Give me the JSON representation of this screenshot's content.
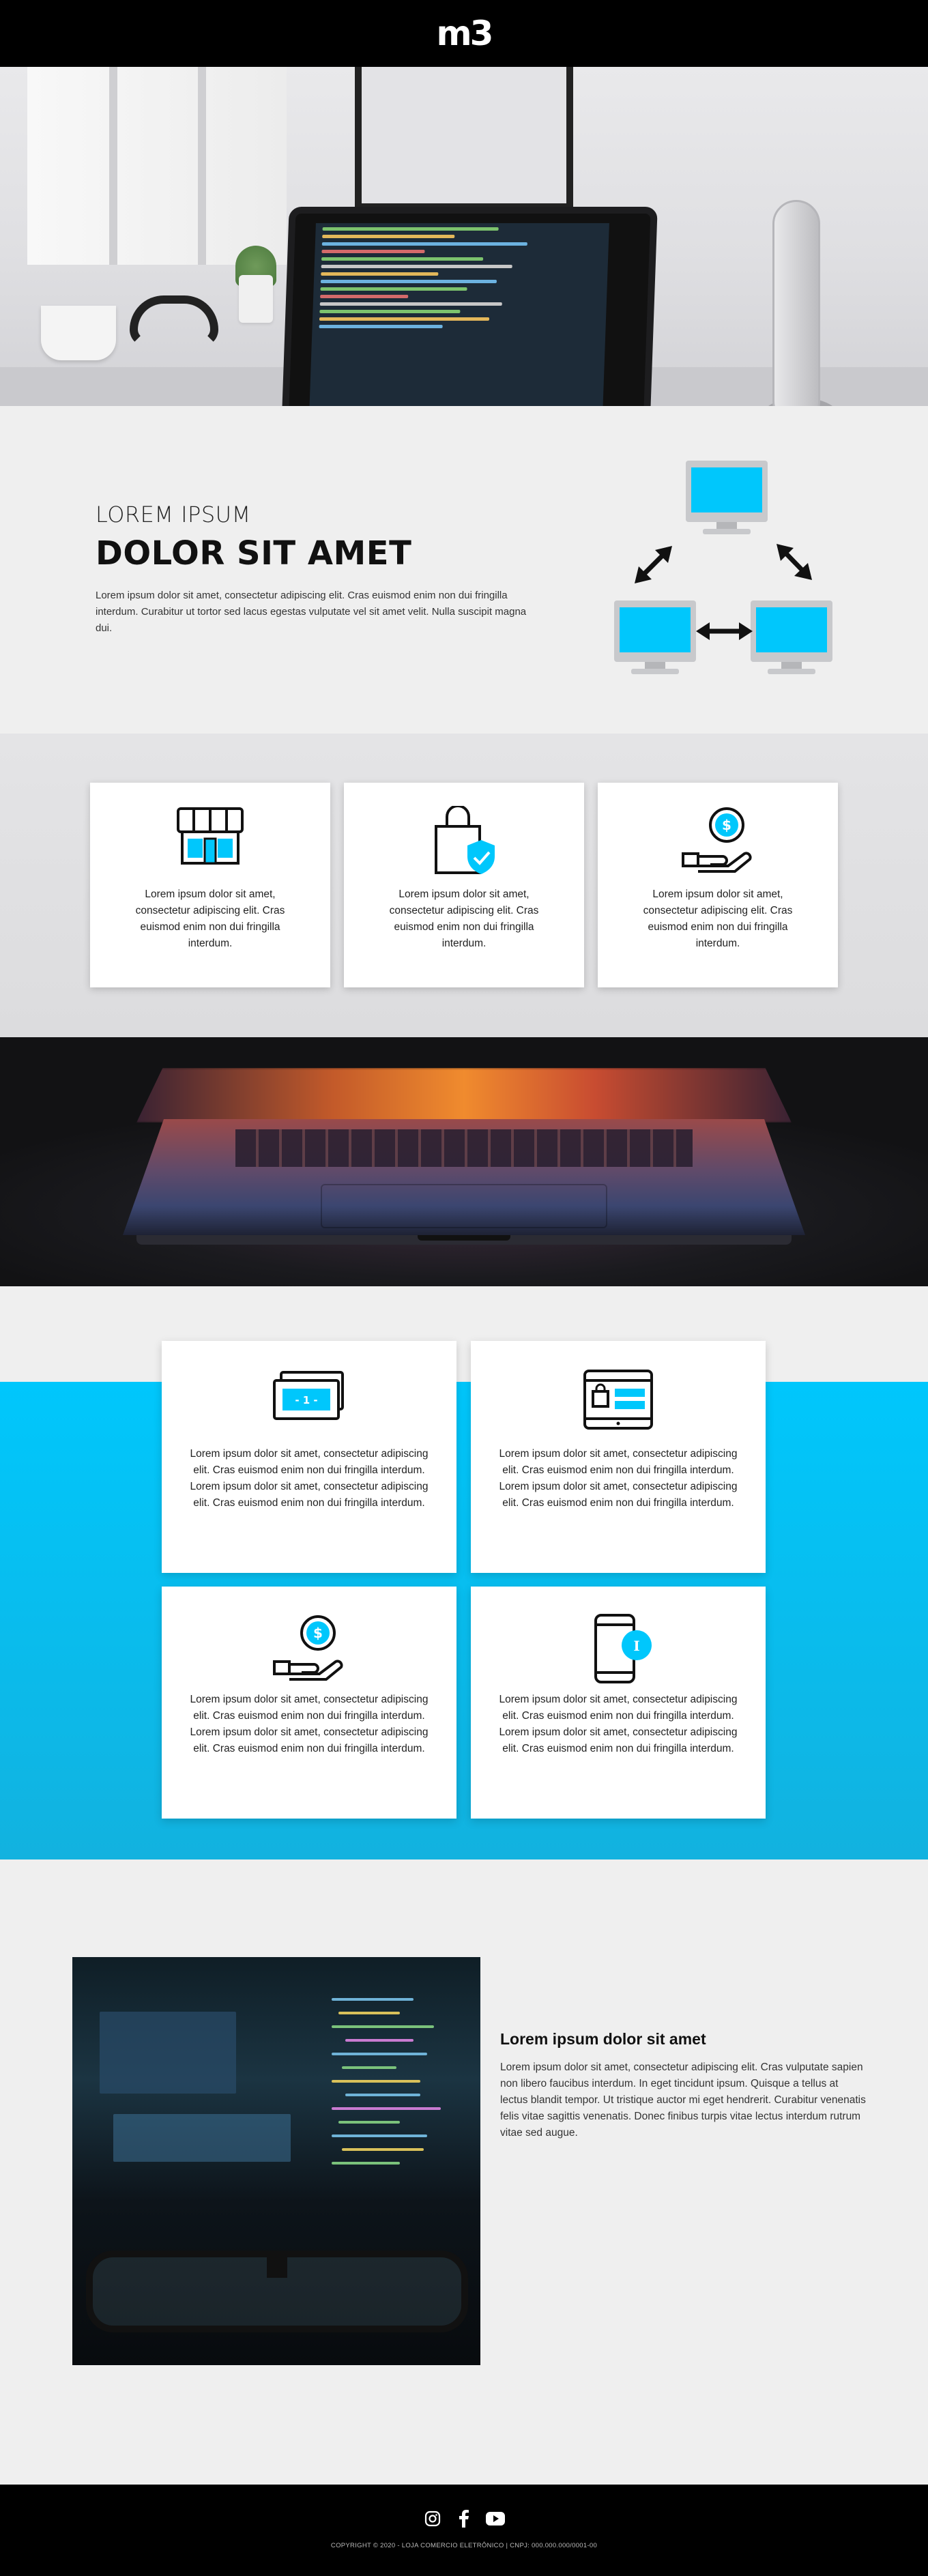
{
  "header": {
    "logo_text": "m3"
  },
  "intro": {
    "subtitle": "LOREM IPSUM",
    "title": "DOLOR SIT AMET",
    "paragraph": "Lorem ipsum dolor sit amet, consectetur adipiscing elit. Cras euismod enim non dui fringilla interdum. Curabitur ut tortor sed lacus egestas vulputate vel sit amet velit. Nulla suscipit magna dui."
  },
  "features": {
    "cards": [
      {
        "icon": "storefront-icon",
        "text": "Lorem ipsum dolor sit amet, consectetur adipiscing elit. Cras euismod enim non dui fringilla interdum."
      },
      {
        "icon": "shopping-bag-shield-icon",
        "text": "Lorem ipsum dolor sit amet, consectetur adipiscing elit. Cras euismod enim non dui fringilla interdum."
      },
      {
        "icon": "hand-coin-icon",
        "text": "Lorem ipsum dolor sit amet, consectetur adipiscing elit. Cras euismod enim non dui fringilla interdum."
      }
    ]
  },
  "grid": {
    "cards": [
      {
        "icon": "banknotes-icon",
        "badge": "- 1 -",
        "text": "Lorem ipsum dolor sit amet, consectetur adipiscing elit. Cras euismod enim non dui fringilla interdum. Lorem ipsum dolor sit amet, consectetur adipiscing elit. Cras euismod enim non dui fringilla interdum."
      },
      {
        "icon": "online-store-icon",
        "text": "Lorem ipsum dolor sit amet, consectetur adipiscing elit. Cras euismod enim non dui fringilla interdum. Lorem ipsum dolor sit amet, consectetur adipiscing elit. Cras euismod enim non dui fringilla interdum."
      },
      {
        "icon": "hand-coin-icon",
        "text": "Lorem ipsum dolor sit amet, consectetur adipiscing elit. Cras euismod enim non dui fringilla interdum. Lorem ipsum dolor sit amet, consectetur adipiscing elit. Cras euismod enim non dui fringilla interdum."
      },
      {
        "icon": "smartphone-info-icon",
        "text": "Lorem ipsum dolor sit amet, consectetur adipiscing elit. Cras euismod enim non dui fringilla interdum. Lorem ipsum dolor sit amet, consectetur adipiscing elit. Cras euismod enim non dui fringilla interdum."
      }
    ]
  },
  "article": {
    "title": "Lorem ipsum dolor sit amet",
    "paragraph": "Lorem ipsum dolor sit amet, consectetur adipiscing elit. Cras vulputate sapien non libero faucibus interdum. In eget tincidunt ipsum. Quisque a tellus at lectus blandit tempor. Ut tristique auctor mi eget hendrerit. Curabitur venenatis felis vitae sagittis venenatis. Donec finibus turpis vitae lectus interdum rutrum vitae sed augue."
  },
  "footer": {
    "social": [
      "instagram-icon",
      "facebook-icon",
      "youtube-icon"
    ],
    "copyright": "COPYRIGHT © 2020 - LOJA COMERCIO ELETRÔNICO | CNPJ: 000.000.000/0001-00"
  },
  "colors": {
    "accent": "#00c7fc",
    "dark": "#000000",
    "background": "#efefef",
    "card": "#ffffff"
  }
}
